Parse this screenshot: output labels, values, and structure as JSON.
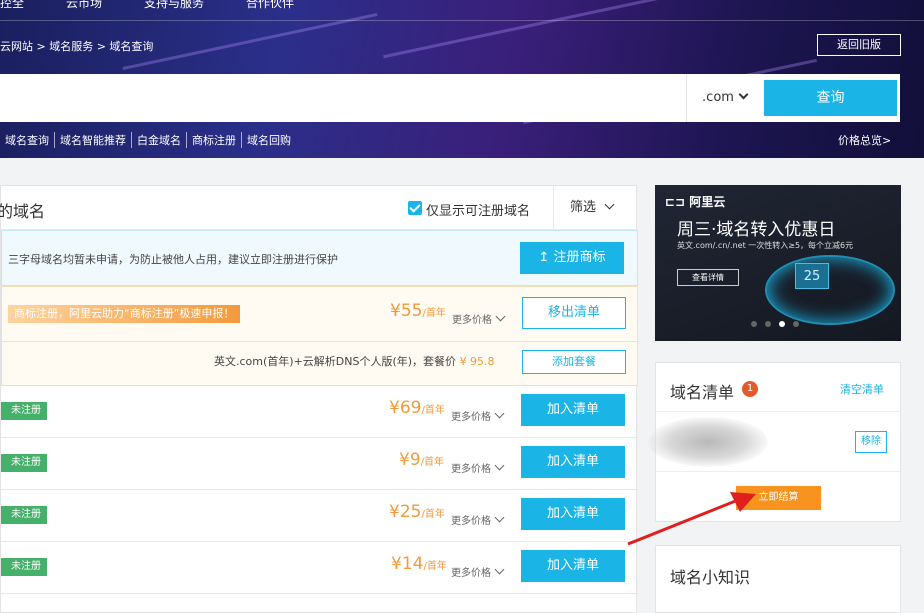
{
  "top_nav": [
    "控全",
    "云市场",
    "支持与服务",
    "合作伙伴"
  ],
  "breadcrumb": "云网站 > 域名服务 > 域名查询",
  "old_version_button": "返回旧版",
  "search": {
    "value": "",
    "tld": ".com",
    "button": "查询"
  },
  "sub_nav": [
    "域名查询",
    "域名智能推荐",
    "白金域名",
    "商标注册",
    "域名回购"
  ],
  "price_overview": "价格总览>",
  "results": {
    "title": "的域名",
    "only_available_label": "仅显示可注册域名",
    "filter_label": "筛选",
    "notice_text": "三字母域名均暂未申请，为防止被他人占用，建议立即注册进行保护",
    "trademark_button": "注册商标",
    "featured": {
      "promo": "商标注册，阿里云助力“商标注册”极速申报！",
      "price": "¥55",
      "unit": "/首年",
      "more_prices": "更多价格",
      "remove_button": "移出清单",
      "package_text": "英文.com(首年)+云解析DNS个人版(年)，套餐价",
      "package_price": "¥ 95.8",
      "add_package_button": "添加套餐"
    },
    "rows": [
      {
        "status": "未注册",
        "price": "¥69",
        "unit": "/首年",
        "more": "更多价格",
        "button": "加入清单"
      },
      {
        "status": "未注册",
        "price": "¥9",
        "unit": "/首年",
        "more": "更多价格",
        "button": "加入清单"
      },
      {
        "status": "未注册",
        "price": "¥25",
        "unit": "/首年",
        "more": "更多价格",
        "button": "加入清单"
      },
      {
        "status": "未注册",
        "price": "¥14",
        "unit": "/首年",
        "more": "更多价格",
        "button": "加入清单"
      }
    ]
  },
  "ad": {
    "logo": "阿里云",
    "headline": "周三·域名转入优惠日",
    "subline": "英文.com/.cn/.net 一次性转入≥5，每个立减6元",
    "button": "查看详情",
    "cube_label": "25"
  },
  "cart": {
    "title": "域名清单",
    "count": "1",
    "clear": "清空清单",
    "remove": "移除",
    "checkout": "立即结算"
  },
  "tips": {
    "title": "域名小知识"
  },
  "colors": {
    "accent": "#1ab5e6",
    "price": "#f39a3b",
    "status": "#44b06a",
    "checkout": "#f7931e",
    "arrow": "#e02020"
  }
}
